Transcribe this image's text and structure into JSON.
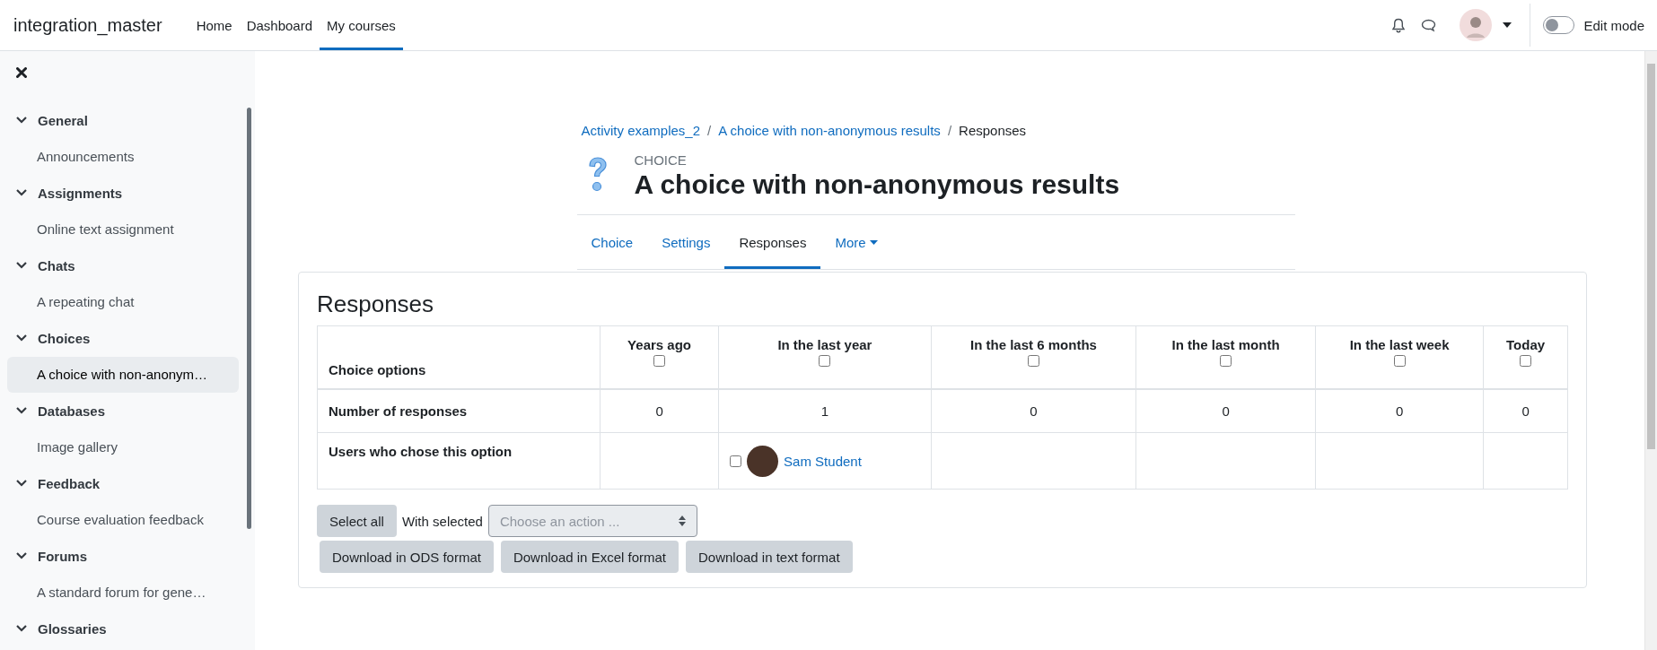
{
  "navbar": {
    "site_name": "integration_master",
    "links": [
      {
        "label": "Home",
        "selected": false
      },
      {
        "label": "Dashboard",
        "selected": false
      },
      {
        "label": "My courses",
        "selected": true
      }
    ],
    "edit_mode": {
      "label": "Edit mode",
      "on": false
    }
  },
  "sidebar": {
    "sections": [
      {
        "title": "General",
        "expanded": true,
        "children": [
          {
            "label": "Announcements",
            "selected": false
          }
        ]
      },
      {
        "title": "Assignments",
        "expanded": true,
        "children": [
          {
            "label": "Online text assignment",
            "selected": false
          }
        ]
      },
      {
        "title": "Chats",
        "expanded": true,
        "children": [
          {
            "label": "A repeating chat",
            "selected": false
          }
        ]
      },
      {
        "title": "Choices",
        "expanded": true,
        "children": [
          {
            "label": "A choice with non-anonym…",
            "selected": true
          }
        ]
      },
      {
        "title": "Databases",
        "expanded": true,
        "children": [
          {
            "label": "Image gallery",
            "selected": false
          }
        ]
      },
      {
        "title": "Feedback",
        "expanded": true,
        "children": [
          {
            "label": "Course evaluation feedback",
            "selected": false
          }
        ]
      },
      {
        "title": "Forums",
        "expanded": true,
        "children": [
          {
            "label": "A standard forum for gene…",
            "selected": false
          }
        ]
      },
      {
        "title": "Glossaries",
        "expanded": true
      }
    ]
  },
  "breadcrumb": [
    {
      "label": "Activity examples_2",
      "kind": "link"
    },
    {
      "separator": "/",
      "label": "A choice with non-anonymous results",
      "kind": "link"
    },
    {
      "separator": "/",
      "label": "Responses",
      "kind": "current"
    }
  ],
  "header": {
    "kicker": "CHOICE",
    "title": "A choice with non-anonymous results"
  },
  "tabs": [
    {
      "label": "Choice",
      "selected": false,
      "kind": "plain"
    },
    {
      "label": "Settings",
      "selected": false,
      "kind": "plain"
    },
    {
      "label": "Responses",
      "selected": true,
      "kind": "plain"
    },
    {
      "label": "More",
      "selected": false,
      "kind": "dropdown"
    }
  ],
  "responses": {
    "title": "Responses",
    "columns": [
      {
        "label": "Choice options"
      },
      {
        "label": "Years ago",
        "checked": false
      },
      {
        "label": "In the last year",
        "checked": false
      },
      {
        "label": "In the last 6 months",
        "checked": false
      },
      {
        "label": "In the last month",
        "checked": false
      },
      {
        "label": "In the last week",
        "checked": false
      },
      {
        "label": "Today",
        "checked": false
      }
    ],
    "rows": [
      {
        "kind": "count",
        "cells": [
          "Number of responses",
          "0",
          "1",
          "0",
          "0",
          "0",
          "0"
        ]
      },
      {
        "kind": "users",
        "cells": [
          "Users who chose this option",
          "",
          [
            {
              "name": "Sam Student",
              "checked": false
            }
          ],
          "",
          "",
          "",
          ""
        ]
      }
    ],
    "select_all": "Select all",
    "with_selected": "With selected",
    "action_placeholder": "Choose an action ...",
    "downloads": [
      "Download in ODS format",
      "Download in Excel format",
      "Download in text format"
    ]
  }
}
